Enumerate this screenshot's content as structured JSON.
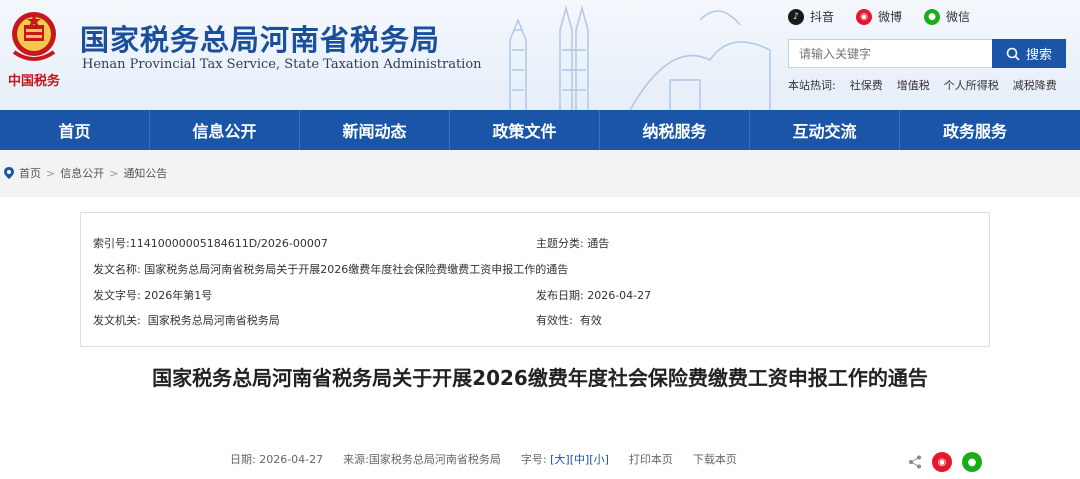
{
  "header": {
    "title": "国家税务总局河南省税务局",
    "subtitle": "Henan Provincial Tax Service, State Taxation Administration",
    "logo_text": "中国税务"
  },
  "social": [
    {
      "label": "抖音",
      "icon": "douyin-icon"
    },
    {
      "label": "微博",
      "icon": "weibo-icon"
    },
    {
      "label": "微信",
      "icon": "wechat-icon"
    }
  ],
  "search": {
    "placeholder": "请输入关键字",
    "button": "搜索"
  },
  "hot": {
    "label": "本站热词:",
    "items": [
      "社保费",
      "增值税",
      "个人所得税",
      "减税降费"
    ]
  },
  "nav": [
    "首页",
    "信息公开",
    "新闻动态",
    "政策文件",
    "纳税服务",
    "互动交流",
    "政务服务"
  ],
  "breadcrumb": [
    "首页",
    "信息公开",
    "通知公告"
  ],
  "meta": {
    "index_label": "索引号:",
    "index_value": "11410000005184611D/2026-00007",
    "category_label": "主题分类:",
    "category_value": "通告",
    "name_label": "发文名称:",
    "name_value": "国家税务总局河南省税务局关于开展2026缴费年度社会保险费缴费工资申报工作的通告",
    "doc_no_label": "发文字号:",
    "doc_no_value": "2026年第1号",
    "date_label": "发布日期:",
    "date_value": "2026-04-27",
    "issuer_label": "发文机关:",
    "issuer_value": "国家税务总局河南省税务局",
    "validity_label": "有效性:",
    "validity_value": "有效"
  },
  "article": {
    "title": "国家税务总局河南省税务局关于开展2026缴费年度社会保险费缴费工资申报工作的通告",
    "date_label": "日期:",
    "date_value": "2026-04-27",
    "source_label": "来源:",
    "source_value": "国家税务总局河南省税务局",
    "fontsize_label": "字号:",
    "fontsize_large": "[大]",
    "fontsize_medium": "[中]",
    "fontsize_small": "[小]",
    "print": "打印本页",
    "download": "下载本页"
  },
  "colors": {
    "brand_blue": "#1b55a8",
    "title_blue": "#1b4f9c",
    "logo_red": "#c8161d"
  }
}
